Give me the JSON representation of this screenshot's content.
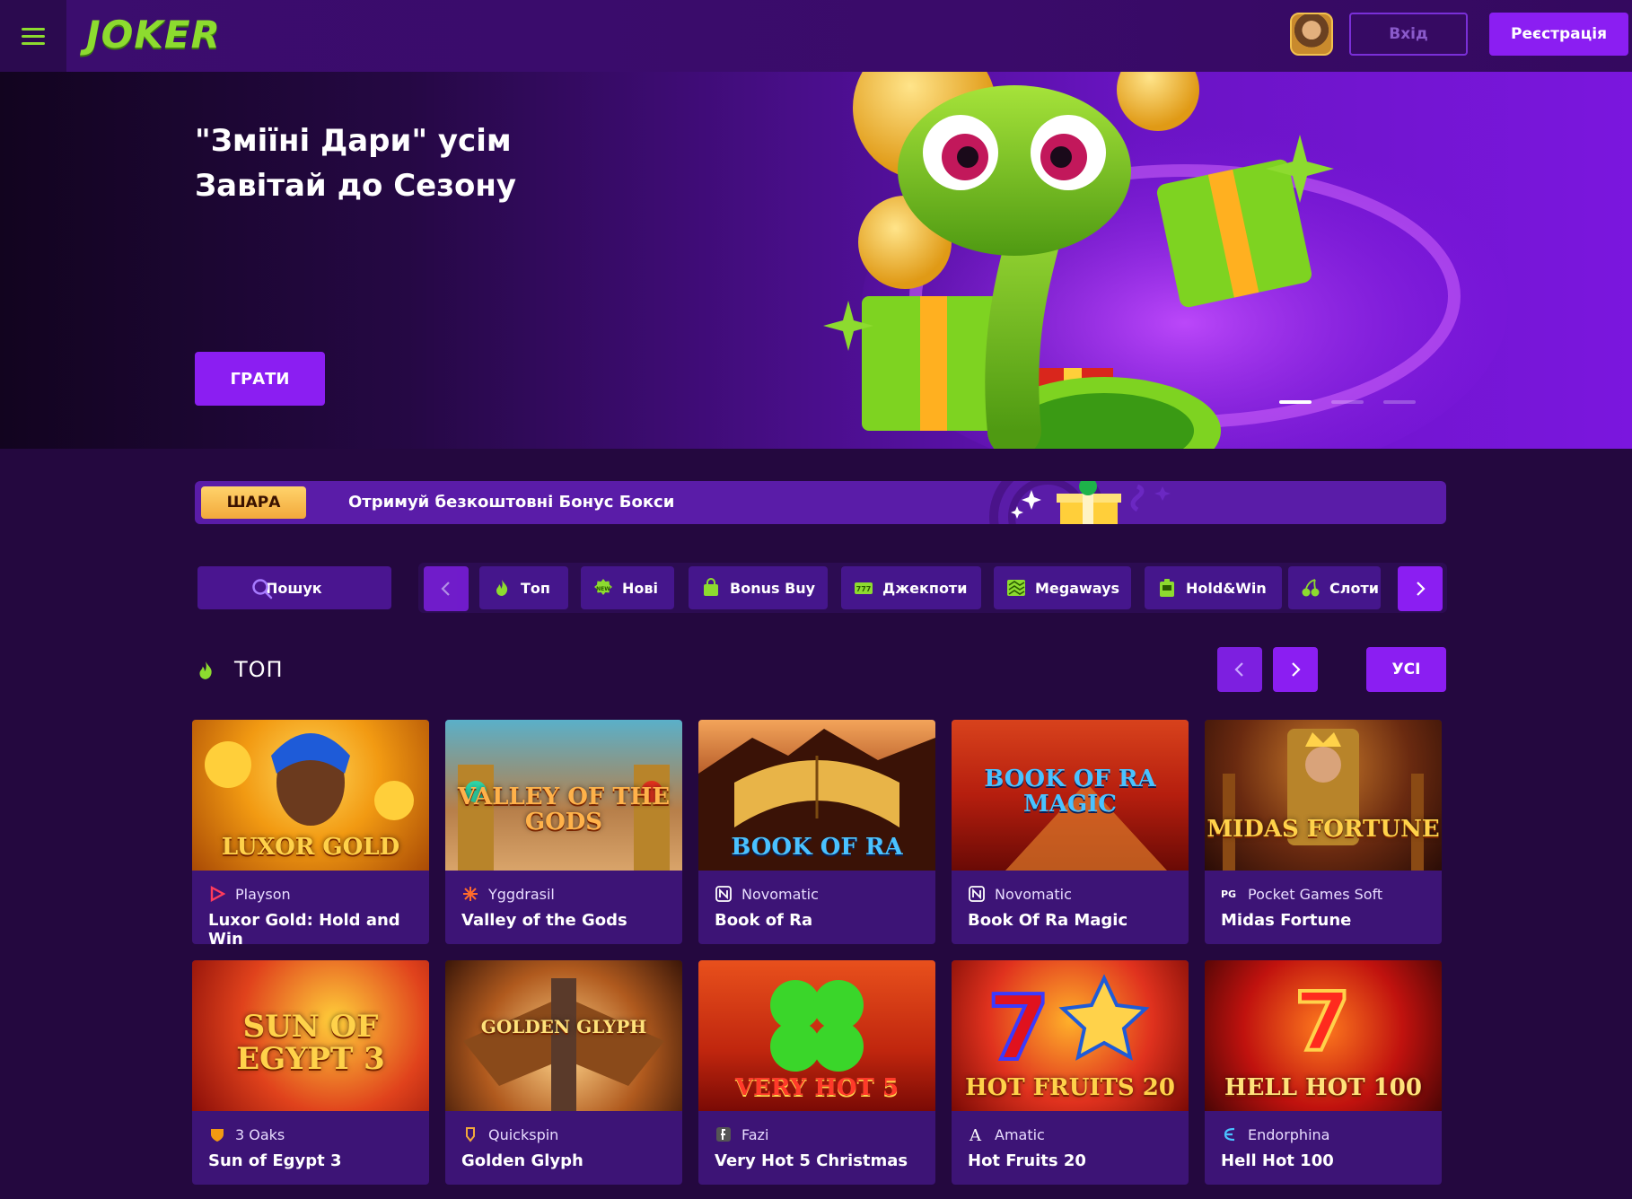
{
  "header": {
    "logo_text": "JOKER",
    "login_label": "Вхід",
    "register_label": "Реєстрація"
  },
  "hero": {
    "title_line1": "\"Зміїні Дари\" усім",
    "title_line2": "Завітай до Сезону",
    "cta_label": "ГРАТИ",
    "slide_count": 3,
    "active_slide": 1
  },
  "promo": {
    "badge": "ШАРА",
    "text": "Отримуй безкоштовні Бонус Бокси"
  },
  "categories": {
    "search_label": "Пошук",
    "items": [
      {
        "label": "Топ",
        "icon": "flame-icon"
      },
      {
        "label": "Нові",
        "icon": "new-badge-icon"
      },
      {
        "label": "Bonus Buy",
        "icon": "shopping-bag-icon"
      },
      {
        "label": "Джекпоти",
        "icon": "jackpot-777-icon"
      },
      {
        "label": "Megaways",
        "icon": "megaways-icon"
      },
      {
        "label": "Hold&Win",
        "icon": "slot-machine-icon"
      },
      {
        "label": "Слоти",
        "icon": "cherry-icon"
      }
    ]
  },
  "section": {
    "title": "ТОП",
    "all_label": "УСІ"
  },
  "games": [
    {
      "provider": "Playson",
      "name": "Luxor Gold: Hold and Win",
      "art_text": "LUXOR GOLD",
      "provider_icon": "playson-icon"
    },
    {
      "provider": "Yggdrasil",
      "name": "Valley of the Gods",
      "art_text": "VALLEY OF THE GODS",
      "provider_icon": "yggdrasil-icon"
    },
    {
      "provider": "Novomatic",
      "name": "Book of Ra",
      "art_text": "BOOK OF RA",
      "provider_icon": "novomatic-icon"
    },
    {
      "provider": "Novomatic",
      "name": "Book Of Ra Magic",
      "art_text": "BOOK OF RA MAGIC",
      "provider_icon": "novomatic-icon"
    },
    {
      "provider": "Pocket Games Soft",
      "name": "Midas Fortune",
      "art_text": "MIDAS FORTUNE",
      "provider_icon": "pgsoft-icon"
    },
    {
      "provider": "3 Oaks",
      "name": "Sun of Egypt 3",
      "art_text": "SUN OF EGYPT 3",
      "provider_icon": "3oaks-icon"
    },
    {
      "provider": "Quickspin",
      "name": "Golden Glyph",
      "art_text": "GOLDEN GLYPH",
      "provider_icon": "quickspin-icon"
    },
    {
      "provider": "Fazi",
      "name": "Very Hot 5 Christmas",
      "art_text": "VERY HOT 5",
      "provider_icon": "fazi-icon"
    },
    {
      "provider": "Amatic",
      "name": "Hot Fruits 20",
      "art_text": "HOT FRUITS 20",
      "provider_icon": "amatic-icon"
    },
    {
      "provider": "Endorphina",
      "name": "Hell Hot 100",
      "art_text": "HELL HOT 100",
      "provider_icon": "endorphina-icon"
    }
  ],
  "colors": {
    "background": "#24083f",
    "accent": "#8b1ef2",
    "brand_green": "#8ddb2f",
    "card": "#3d1476",
    "badge_gold": "#f2a93b"
  }
}
